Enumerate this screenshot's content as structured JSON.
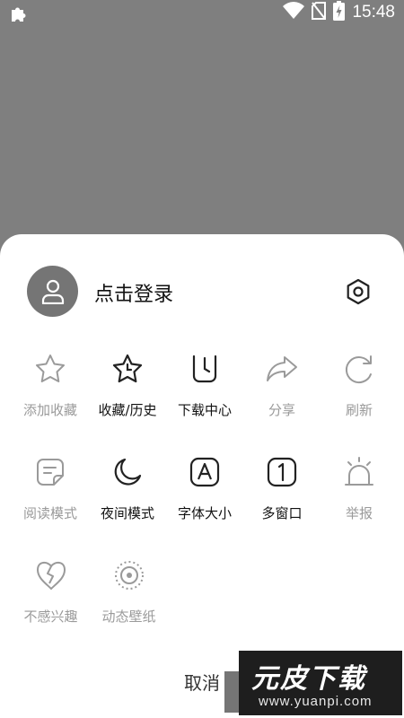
{
  "status_bar": {
    "time": "15:48"
  },
  "profile": {
    "login_label": "点击登录"
  },
  "menu": {
    "row1": [
      {
        "label": "添加收藏",
        "icon": "star-icon",
        "enabled": false
      },
      {
        "label": "收藏/历史",
        "icon": "star-clock-icon",
        "enabled": true
      },
      {
        "label": "下载中心",
        "icon": "download-icon",
        "enabled": true
      },
      {
        "label": "分享",
        "icon": "share-icon",
        "enabled": false
      },
      {
        "label": "刷新",
        "icon": "refresh-icon",
        "enabled": false
      }
    ],
    "row2": [
      {
        "label": "阅读模式",
        "icon": "reading-mode-icon",
        "enabled": false
      },
      {
        "label": "夜间模式",
        "icon": "moon-icon",
        "enabled": true
      },
      {
        "label": "字体大小",
        "icon": "font-size-icon",
        "enabled": true
      },
      {
        "label": "多窗口",
        "icon": "multi-window-icon",
        "enabled": true
      },
      {
        "label": "举报",
        "icon": "report-alarm-icon",
        "enabled": false
      }
    ],
    "row3": [
      {
        "label": "不感兴趣",
        "icon": "broken-heart-icon",
        "enabled": false
      },
      {
        "label": "动态壁纸",
        "icon": "live-wallpaper-icon",
        "enabled": false
      }
    ]
  },
  "cancel_label": "取消",
  "watermark": {
    "title": "元皮下载",
    "url": "www.yuanpi.com"
  }
}
